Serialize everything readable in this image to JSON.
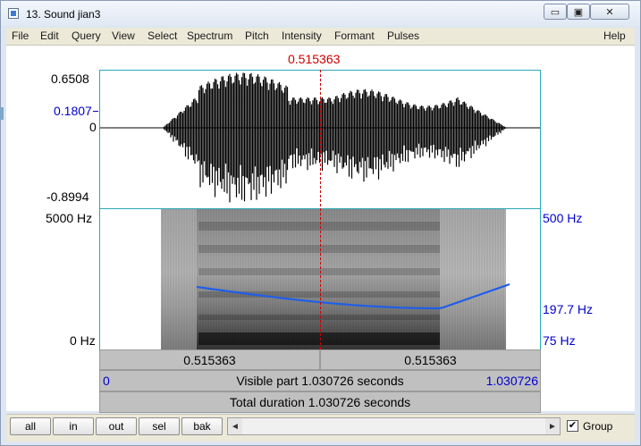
{
  "window": {
    "title": "13. Sound jian3",
    "minimize_glyph": "▭",
    "maximize_glyph": "▣",
    "close_glyph": "✕"
  },
  "menu": [
    "File",
    "Edit",
    "Query",
    "View",
    "Select",
    "Spectrum",
    "Pitch",
    "Intensity",
    "Formant",
    "Pulses",
    "Help"
  ],
  "cursor": {
    "time_label": "0.515363"
  },
  "waveform": {
    "max": "0.6508",
    "cursor_value": "0.1807",
    "zero": "0",
    "min": "-0.8994"
  },
  "spectrogram": {
    "top_freq": "5000 Hz",
    "bottom_freq": "0 Hz",
    "pitch_top": "500 Hz",
    "pitch_value": "197.7 Hz",
    "pitch_bottom": "75 Hz",
    "pitch_line_color": "#1f5ee8"
  },
  "time_bars": {
    "left_segment": "0.515363",
    "right_segment": "0.515363",
    "visible_start": "0",
    "visible_label": "Visible part 1.030726 seconds",
    "visible_end": "1.030726",
    "total_label": "Total duration 1.030726 seconds"
  },
  "bottom": {
    "buttons": [
      "all",
      "in",
      "out",
      "sel",
      "bak"
    ],
    "scroll_left": "◄",
    "scroll_right": "►",
    "group_checked": "✔",
    "group_label": "Group"
  }
}
